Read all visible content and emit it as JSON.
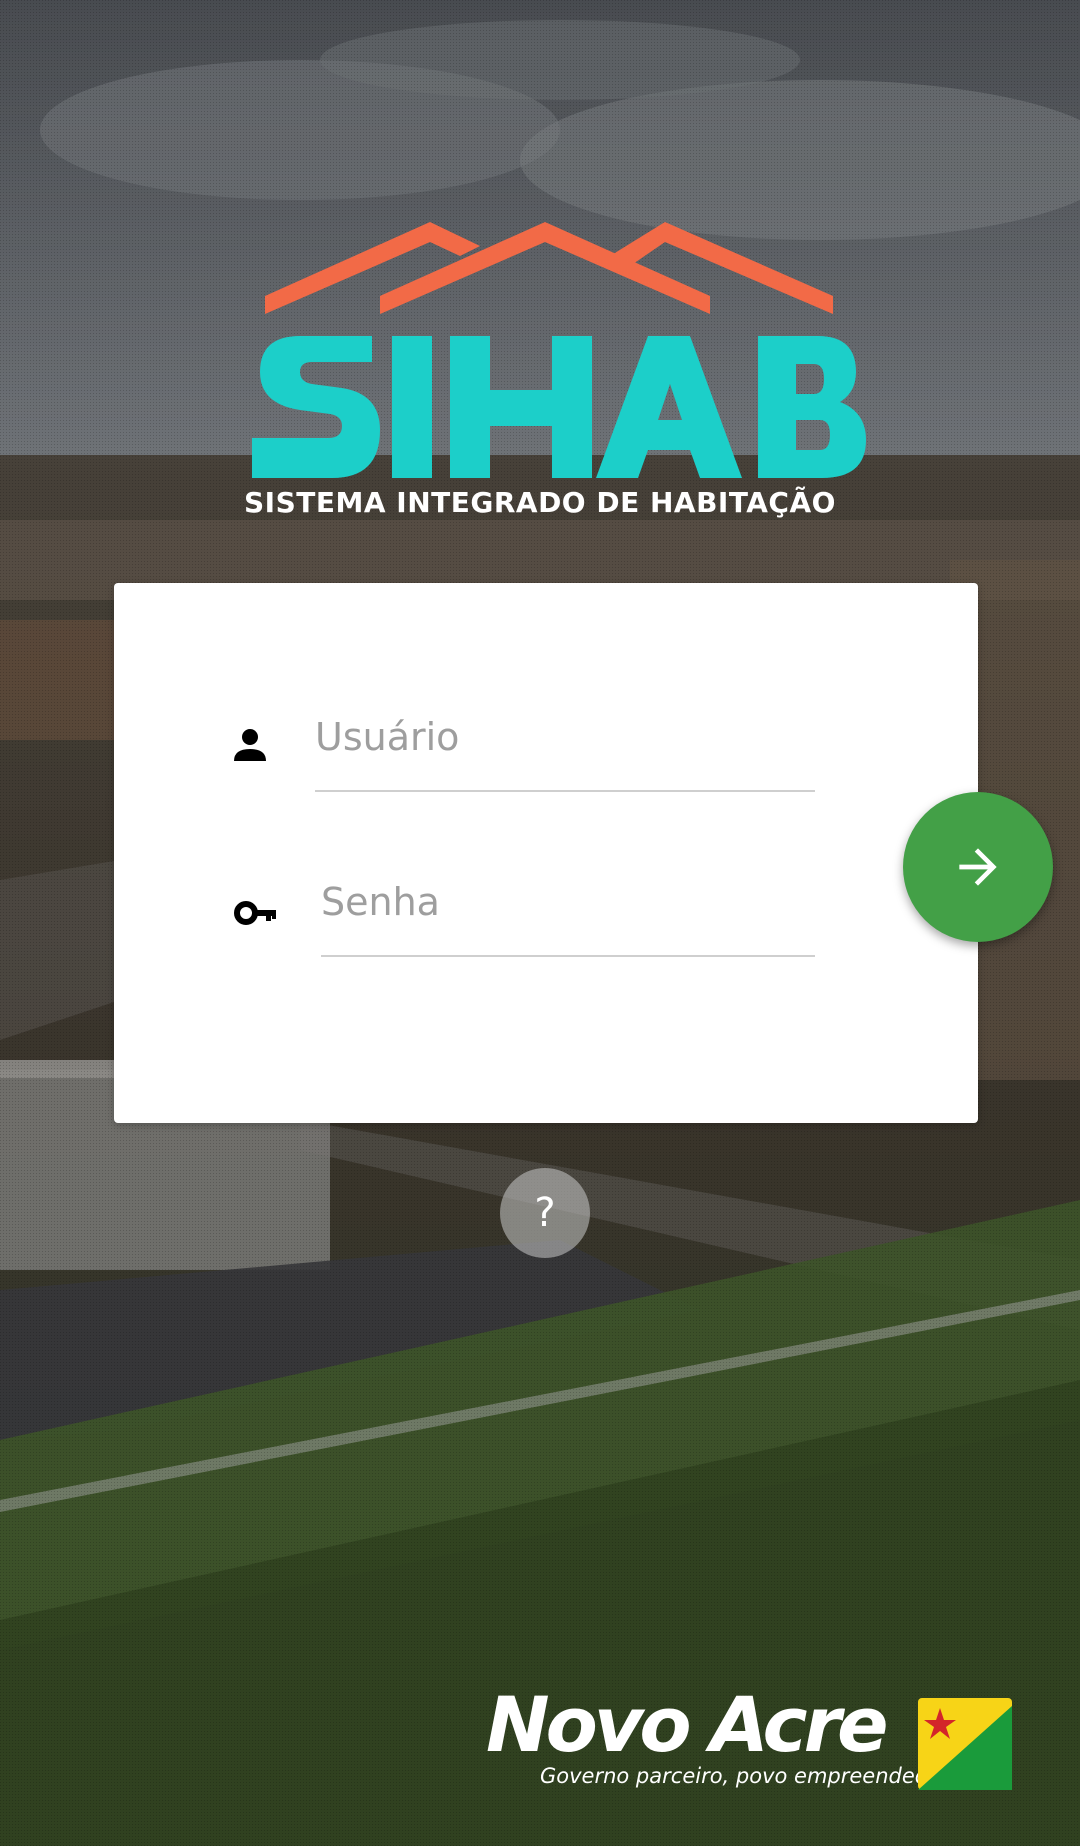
{
  "colors": {
    "logo_roof": "#f26a47",
    "logo_text": "#1ccfc9",
    "login_button": "#43a047"
  },
  "logo": {
    "wordmark": "SIHAB",
    "subtitle": "SISTEMA INTEGRADO DE HABITAÇÃO"
  },
  "login": {
    "username": {
      "placeholder": "Usuário",
      "value": "",
      "icon": "person-icon"
    },
    "password": {
      "placeholder": "Senha",
      "value": "",
      "icon": "key-icon"
    },
    "submit_icon": "arrow-right-icon"
  },
  "help": {
    "label": "?"
  },
  "footer": {
    "brand": "Novo Acre",
    "tagline": "Governo parceiro, povo empreendedor.",
    "flag_icon": "acre-flag-icon"
  }
}
